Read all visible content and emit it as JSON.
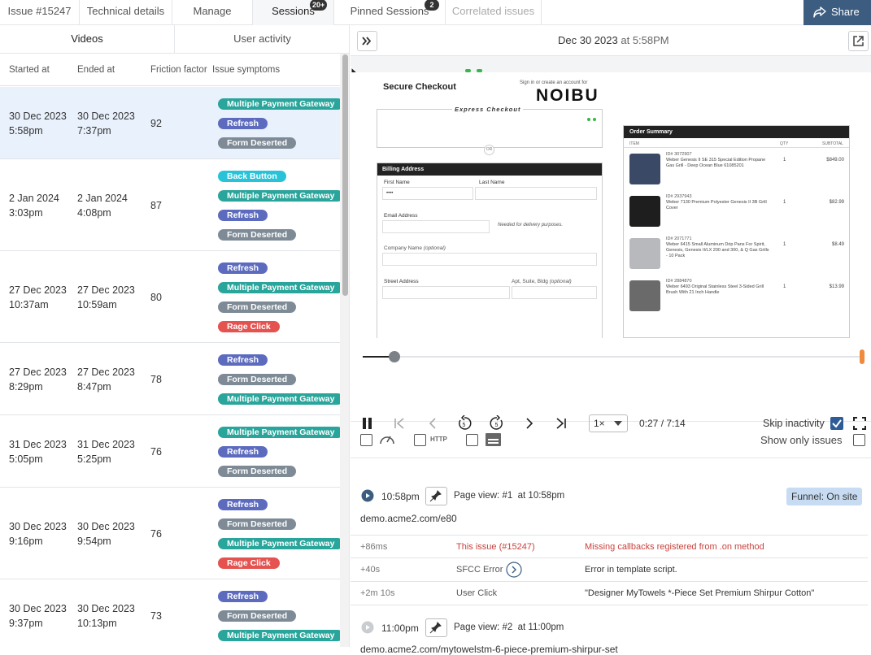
{
  "tabs": [
    {
      "label": "Issue #15247"
    },
    {
      "label": "Technical details"
    },
    {
      "label": "Manage"
    },
    {
      "label": "Sessions",
      "badge": "20+"
    },
    {
      "label": "Pinned Sessions",
      "badge": "2"
    },
    {
      "label": "Correlated issues"
    }
  ],
  "share_label": "Share",
  "left_tabs": {
    "videos": "Videos",
    "user_activity": "User activity"
  },
  "columns": {
    "started": "Started at",
    "ended": "Ended at",
    "friction": "Friction factor",
    "symptoms": "Issue symptoms"
  },
  "colors": {
    "multiple_payment_gateway": "#2aa59b",
    "refresh": "#5d6bbf",
    "form_deserted": "#7e8b96",
    "back_button": "#29c3d9",
    "rage_click": "#e4534f",
    "share_bg": "#3c5d80",
    "selected_row": "#e9f1fc"
  },
  "sessions": [
    {
      "start_date": "30 Dec 2023",
      "start_time": "5:58pm",
      "end_date": "30 Dec 2023",
      "end_time": "7:37pm",
      "friction": "92",
      "symptoms": [
        "Multiple Payment Gateway",
        "Refresh",
        "Form Deserted"
      ]
    },
    {
      "start_date": "2 Jan 2024",
      "start_time": "3:03pm",
      "end_date": "2 Jan 2024",
      "end_time": "4:08pm",
      "friction": "87",
      "symptoms": [
        "Back Button",
        "Multiple Payment Gateway",
        "Refresh",
        "Form Deserted"
      ]
    },
    {
      "start_date": "27 Dec 2023",
      "start_time": "10:37am",
      "end_date": "27 Dec 2023",
      "end_time": "10:59am",
      "friction": "80",
      "symptoms": [
        "Refresh",
        "Multiple Payment Gateway",
        "Form Deserted",
        "Rage Click"
      ]
    },
    {
      "start_date": "27 Dec 2023",
      "start_time": "8:29pm",
      "end_date": "27 Dec 2023",
      "end_time": "8:47pm",
      "friction": "78",
      "symptoms": [
        "Refresh",
        "Form Deserted",
        "Multiple Payment Gateway"
      ]
    },
    {
      "start_date": "31 Dec 2023",
      "start_time": "5:05pm",
      "end_date": "31 Dec 2023",
      "end_time": "5:25pm",
      "friction": "76",
      "symptoms": [
        "Multiple Payment Gateway",
        "Refresh",
        "Form Deserted"
      ]
    },
    {
      "start_date": "30 Dec 2023",
      "start_time": "9:16pm",
      "end_date": "30 Dec 2023",
      "end_time": "9:54pm",
      "friction": "76",
      "symptoms": [
        "Refresh",
        "Form Deserted",
        "Multiple Payment Gateway",
        "Rage Click"
      ]
    },
    {
      "start_date": "30 Dec 2023",
      "start_time": "9:37pm",
      "end_date": "30 Dec 2023",
      "end_time": "10:13pm",
      "friction": "73",
      "symptoms": [
        "Refresh",
        "Form Deserted",
        "Multiple Payment Gateway"
      ]
    }
  ],
  "player": {
    "date": "Dec 30 2023",
    "at": "at",
    "time": "5:58PM",
    "progress": 0.063,
    "speed": "1×",
    "position": "0:27 / 7:14",
    "skip_inactivity": "Skip inactivity",
    "show_only_issues": "Show only issues",
    "http_label": "HTTP"
  },
  "checkout": {
    "title": "Secure Checkout",
    "signin": "Sign in or create an account for",
    "brand": "NOIBU",
    "express": "Express Checkout",
    "or": "OR",
    "billing": "Billing Address",
    "first_name": "First Name",
    "last_name": "Last Name",
    "first_value": "••••",
    "email": "Email Address",
    "email_note": "Needed for delivery purposes.",
    "company": "Company Name",
    "company_opt": "(optional)",
    "street": "Street Address",
    "apt": "Apt, Suite, Bldg",
    "apt_opt": "(optional)",
    "summary": "Order Summary",
    "col_item": "ITEM",
    "col_qty": "QTY",
    "col_sub": "SUBTOTAL",
    "items": [
      {
        "id": "ID# 3072907",
        "name": "Weber Genesis II SE 315 Special Edition Propane Gas Grill - Deep Ocean Blue 61085201",
        "qty": "1",
        "price": "$849.00"
      },
      {
        "id": "ID# 2937943",
        "name": "Weber 7130 Premium Polyester Genesis II 3B Grill Cover",
        "qty": "1",
        "price": "$82.99"
      },
      {
        "id": "ID# 2071771",
        "name": "Weber 6415 Small Aluminum Drip Pans For Spirit, Genesis, Genesis II/LX 200 and 300, & Q Gas Grills - 10 Pack",
        "qty": "1",
        "price": "$8.49"
      },
      {
        "id": "ID# 2884870",
        "name": "Weber 6493 Original Stainless Steel 3-Sided Grill Brush With 21 Inch Handle",
        "qty": "1",
        "price": "$13.99"
      }
    ]
  },
  "events": {
    "pv1": {
      "time": "10:58pm",
      "label": "Page view: #1",
      "at": "at 10:58pm",
      "funnel": "Funnel: On site",
      "url": "demo.acme2.com/e80"
    },
    "rows": [
      {
        "offset": "+86ms",
        "type": "This issue (#15247)",
        "desc": "Missing callbacks registered from .on method"
      },
      {
        "offset": "+40s",
        "type": "SFCC Error",
        "desc": "Error in template script."
      },
      {
        "offset": "+2m 10s",
        "type": "User Click",
        "desc": "\"Designer MyTowels *-Piece Set Premium Shirpur Cotton\""
      }
    ],
    "pv2": {
      "time": "11:00pm",
      "label": "Page view: #2",
      "at": "at 11:00pm",
      "url": "demo.acme2.com/mytowelstm-6-piece-premium-shirpur-set"
    }
  }
}
